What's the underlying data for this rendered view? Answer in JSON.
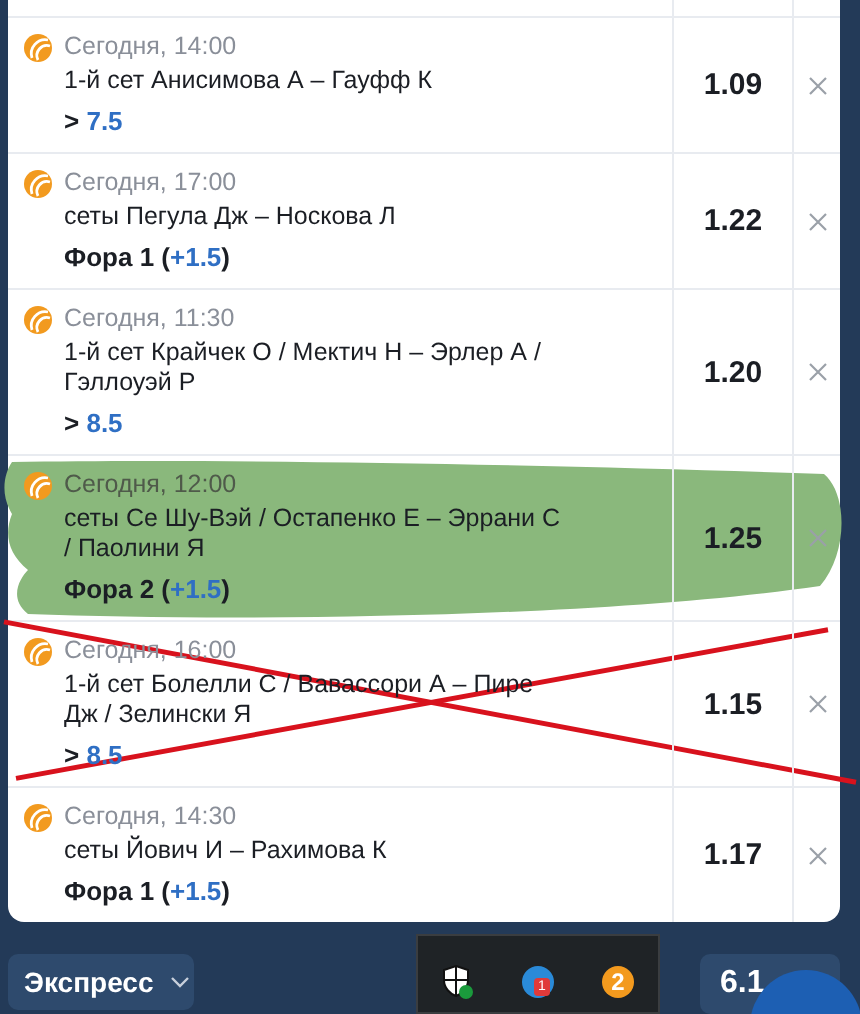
{
  "bets": [
    {
      "time": "Сегодня, 14:00",
      "event": "1-й сет Анисимова А – Гауфф К",
      "pick": [
        {
          "text": "> ",
          "accent": false
        },
        {
          "text": "7.5",
          "accent": true
        }
      ],
      "odds": "1.09",
      "highlighted": false,
      "crossed_out": false
    },
    {
      "time": "Сегодня, 17:00",
      "event": "сеты Пегула Дж – Носкова Л",
      "pick": [
        {
          "text": "Фора 1 (",
          "accent": false
        },
        {
          "text": "+1.5",
          "accent": true
        },
        {
          "text": ")",
          "accent": false
        }
      ],
      "odds": "1.22",
      "highlighted": false,
      "crossed_out": false
    },
    {
      "time": "Сегодня, 11:30",
      "event": "1-й сет Крайчек О / Мектич Н – Эрлер А / Гэллоуэй Р",
      "pick": [
        {
          "text": "> ",
          "accent": false
        },
        {
          "text": "8.5",
          "accent": true
        }
      ],
      "odds": "1.20",
      "highlighted": false,
      "crossed_out": false
    },
    {
      "time": "Сегодня, 12:00",
      "event": "сеты Се Шу-Вэй / Остапенко Е – Эррани С / Паолини Я",
      "pick": [
        {
          "text": "Фора 2 (",
          "accent": false
        },
        {
          "text": "+1.5",
          "accent": true
        },
        {
          "text": ")",
          "accent": false
        }
      ],
      "odds": "1.25",
      "highlighted": true,
      "crossed_out": false
    },
    {
      "time": "Сегодня, 16:00",
      "event": "1-й сет Болелли С / Вавассори А – Пире Дж / Зелински Я",
      "pick": [
        {
          "text": "> ",
          "accent": false
        },
        {
          "text": "8.5",
          "accent": true
        }
      ],
      "odds": "1.15",
      "highlighted": false,
      "crossed_out": true
    },
    {
      "time": "Сегодня, 14:30",
      "event": "сеты Йович И – Рахимова К",
      "pick": [
        {
          "text": "Фора 1 (",
          "accent": false
        },
        {
          "text": "+1.5",
          "accent": true
        },
        {
          "text": ")",
          "accent": false
        }
      ],
      "odds": "1.17",
      "highlighted": false,
      "crossed_out": false
    }
  ],
  "bet_type": {
    "label": "Экспресс"
  },
  "tray": {
    "badge": "1",
    "orange_count": "2"
  },
  "total_odds": "6.1"
}
